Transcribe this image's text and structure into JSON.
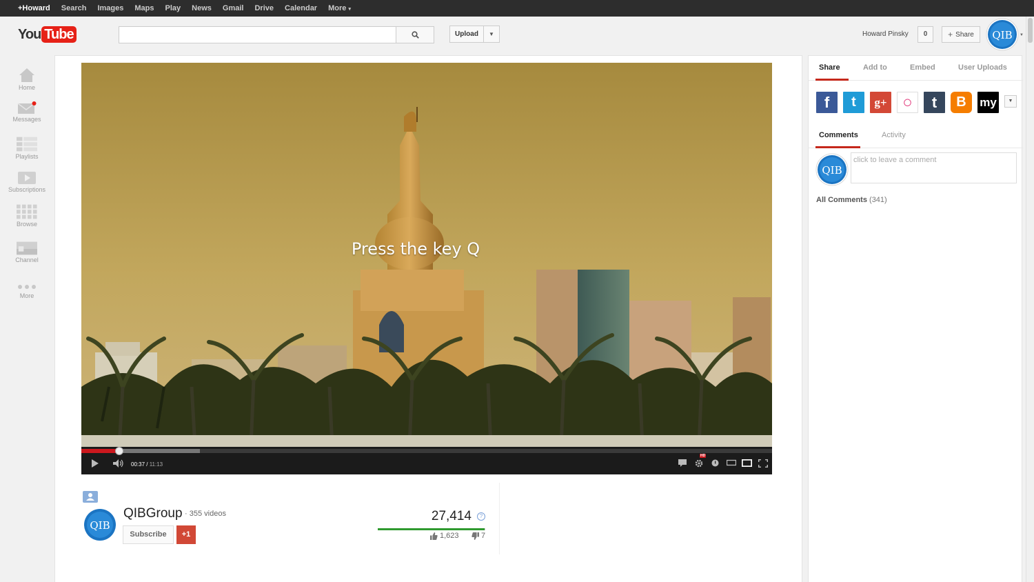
{
  "gbar": {
    "items": [
      "+Howard",
      "Search",
      "Images",
      "Maps",
      "Play",
      "News",
      "Gmail",
      "Drive",
      "Calendar",
      "More"
    ]
  },
  "masthead": {
    "logo_you": "You",
    "logo_tube": "Tube",
    "search_placeholder": "",
    "upload_label": "Upload",
    "user_name": "Howard Pinsky",
    "notification_count": "0",
    "share_label": "Share"
  },
  "guide": {
    "items": [
      {
        "label": "Home",
        "icon": "home-icon"
      },
      {
        "label": "Messages",
        "icon": "messages-icon"
      },
      {
        "label": "Playlists",
        "icon": "playlists-icon"
      },
      {
        "label": "Subscriptions",
        "icon": "subscriptions-icon"
      },
      {
        "label": "Browse",
        "icon": "browse-icon"
      },
      {
        "label": "Channel",
        "icon": "channel-icon"
      },
      {
        "label": "More",
        "icon": "more-icon"
      }
    ]
  },
  "player": {
    "overlay_text": "Press the key Q",
    "current_time": "00:37",
    "duration": "11:13",
    "progress_fraction": 0.055,
    "buffered_fraction": 0.172,
    "accent": "#cc181e"
  },
  "channel": {
    "name": "QIBGroup",
    "video_count": "355 videos",
    "avatar_text": "QIB",
    "subscribe_label": "Subscribe",
    "plusone_label": "+1"
  },
  "stats": {
    "views": "27,414",
    "help": "?",
    "likes": "1,623",
    "dislikes": "7",
    "like_fraction": 0.996
  },
  "right_panel": {
    "tabs": [
      "Share",
      "Add to",
      "Embed",
      "User Uploads"
    ],
    "social": [
      {
        "icon": "facebook-icon",
        "glyph": "f",
        "color": "#3b5998"
      },
      {
        "icon": "twitter-icon",
        "glyph": "t",
        "color": "#1f9bd7"
      },
      {
        "icon": "google-plus-icon",
        "glyph": "g+",
        "color": "#d34836"
      },
      {
        "icon": "orkut-icon",
        "glyph": "○",
        "color": "#e23d7e"
      },
      {
        "icon": "tumblr-icon",
        "glyph": "t",
        "color": "#35465c"
      },
      {
        "icon": "blogger-icon",
        "glyph": "B",
        "color": "#f57d00"
      },
      {
        "icon": "myspace-icon",
        "glyph": "my",
        "color": "#000000"
      }
    ],
    "comment_tabs": [
      "Comments",
      "Activity"
    ],
    "comment_placeholder": "click to leave a comment",
    "all_comments_label": "All Comments",
    "all_comments_count": "(341)"
  }
}
